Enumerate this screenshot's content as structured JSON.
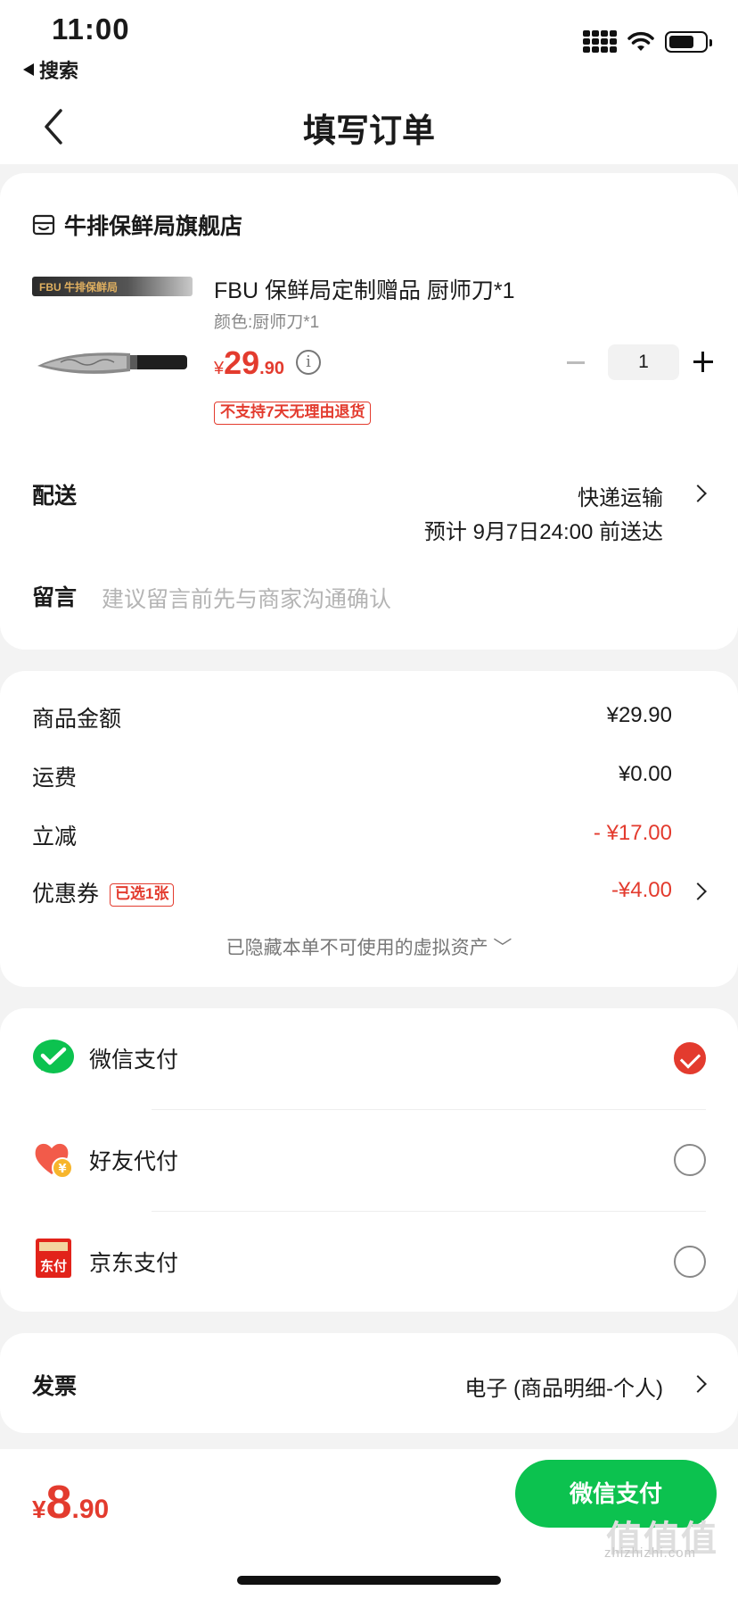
{
  "status_bar": {
    "time": "11:00",
    "back_app": "搜索"
  },
  "nav": {
    "title": "填写订单"
  },
  "store": {
    "name": "牛排保鲜局旗舰店",
    "product": {
      "title": "FBU 保鲜局定制赠品 厨师刀*1",
      "variant": "颜色:厨师刀*1",
      "price_currency": "¥",
      "price_int": "29",
      "price_dec": ".90",
      "quantity": "1",
      "return_policy_tag": "不支持7天无理由退货",
      "thumb_brand_text": "FBU 牛排保鲜局"
    },
    "delivery": {
      "label": "配送",
      "method": "快递运输",
      "eta": "预计 9月7日24:00 前送达"
    },
    "memo": {
      "label": "留言",
      "placeholder": "建议留言前先与商家沟通确认"
    }
  },
  "summary": {
    "goods_label": "商品金额",
    "goods_value": "¥29.90",
    "shipping_label": "运费",
    "shipping_value": "¥0.00",
    "discount_label": "立减",
    "discount_value": "- ¥17.00",
    "coupon_label": "优惠券",
    "coupon_tag": "已选1张",
    "coupon_value": "-¥4.00",
    "hidden_assets_note": "已隐藏本单不可使用的虚拟资产 ﹀"
  },
  "payment": {
    "options": [
      {
        "label": "微信支付",
        "icon": "wechat-pay-icon",
        "selected": true
      },
      {
        "label": "好友代付",
        "icon": "friend-pay-icon",
        "selected": false
      },
      {
        "label": "京东支付",
        "icon": "jd-pay-icon",
        "selected": false
      }
    ],
    "jd_icon_text": "东付",
    "friend_icon_text": "¥"
  },
  "invoice": {
    "label": "发票",
    "value": "电子 (商品明细-个人)"
  },
  "bottom": {
    "total_currency": "¥",
    "total_int": "8",
    "total_dec": ".90",
    "pay_button": "微信支付",
    "watermark_big": "值值值",
    "watermark": "zhizhizhi.com"
  },
  "colors": {
    "accent_red": "#e33b2e",
    "wechat_green": "#0cc24f"
  }
}
